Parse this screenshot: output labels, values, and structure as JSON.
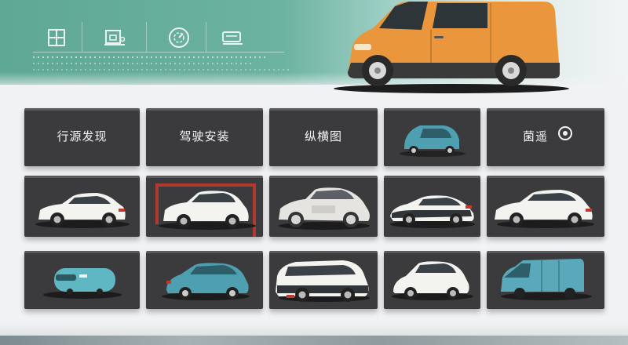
{
  "hero": {
    "icons": [
      "document-icon",
      "archive-icon",
      "gauge-icon",
      "battery-icon"
    ]
  },
  "menu_tiles": [
    {
      "label": "行源发现"
    },
    {
      "label": "驾驶安装"
    },
    {
      "label": "纵横图"
    },
    {
      "label": ""
    },
    {
      "label": "菌遥"
    }
  ],
  "colors": {
    "hero_green": "#5fa894",
    "van_orange": "#e9963c",
    "tile_dark": "#3b3b3d",
    "car_white": "#f3f3f0",
    "car_teal": "#4e9fb0",
    "accent_red": "#c0392b"
  }
}
